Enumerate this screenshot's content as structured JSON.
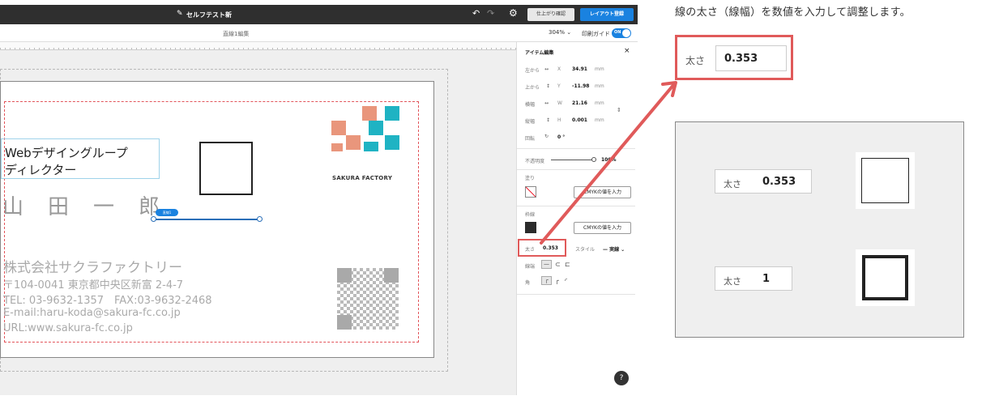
{
  "editor": {
    "title": "セルフテスト新",
    "finish_check_label": "仕上がり確認",
    "layout_register_label": "レイアウト登録",
    "sub_title": "直線1編集",
    "zoom": "304%",
    "print_guide_label": "印刷ガイド",
    "print_guide_toggle": "ON"
  },
  "card": {
    "title_line1": "Webデザイングループ",
    "title_line2": "ディレクター",
    "name": "山　田　一　郎",
    "line_tag": "直線1",
    "logo_text": "SAKURA FACTORY",
    "company": "株式会社サクラファクトリー",
    "address": "〒104-0041 東京都中央区新富 2-4-7",
    "tel": "TEL: 03-9632-1357　FAX:03-9632-2468",
    "email": "E-mail:haru-koda@sakura-fc.co.jp",
    "url": "URL:www.sakura-fc.co.jp"
  },
  "panel": {
    "heading": "アイテム編集",
    "close": "×",
    "left_label": "左から",
    "x_axis": "X",
    "x_value": "34.91",
    "x_unit": "mm",
    "top_label": "上から",
    "y_axis": "Y",
    "y_value": "-11.98",
    "y_unit": "mm",
    "width_label": "横幅",
    "w_axis": "W",
    "w_value": "21.16",
    "w_unit": "mm",
    "height_label": "縦幅",
    "h_axis": "H",
    "h_value": "0.001",
    "h_unit": "mm",
    "rotate_label": "回転",
    "rotate_value": "0 °",
    "opacity_label": "不透明度",
    "opacity_value": "100%",
    "fill_label": "塗り",
    "fill_cmyk_button": "CMYKの値を入力",
    "stroke_label": "枠線",
    "stroke_cmyk_button": "CMYKの値を入力",
    "thickness_label": "太さ",
    "thickness_value": "0.353",
    "style_label": "スタイル",
    "style_value": "— 実線",
    "line_end_label": "線端",
    "corner_label": "角",
    "help": "?"
  },
  "illustration": {
    "caption": "線の太さ（線幅）を数値を入力して調整します。",
    "zoom_label": "太さ",
    "zoom_value": "0.353",
    "example1_label": "太さ",
    "example1_value": "0.353",
    "example2_label": "太さ",
    "example2_value": "1"
  },
  "colors": {
    "accent_blue": "#1a82e0",
    "topbar": "#2f2f2f",
    "highlight_red": "#e05a5a",
    "logo_salmon": "#e9967c",
    "logo_teal": "#1fb3c3",
    "line_blue": "#2a6fb8"
  }
}
